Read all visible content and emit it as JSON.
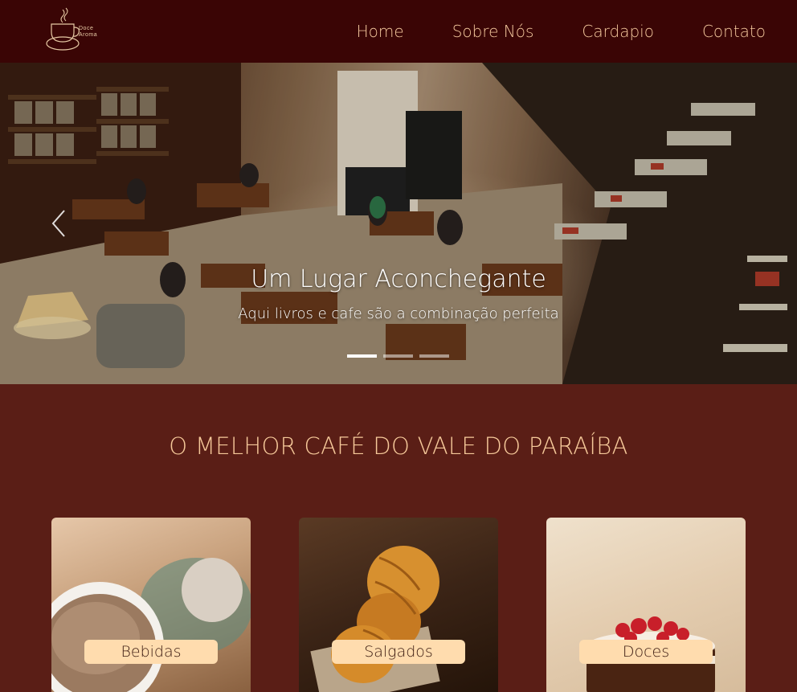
{
  "brand": {
    "name_line1": "Doce",
    "name_line2": "Aroma"
  },
  "nav": {
    "items": [
      {
        "label": "Home"
      },
      {
        "label": "Sobre Nós"
      },
      {
        "label": "Cardapio"
      },
      {
        "label": "Contato"
      }
    ]
  },
  "hero": {
    "title": "Um Lugar Aconchegante",
    "subtitle": "Aqui livros e cafe são a combinação perfeita",
    "slide_count": 3,
    "active_slide": 1
  },
  "section": {
    "title": "O MELHOR CAFÉ DO VALE DO PARAÍBA"
  },
  "cards": [
    {
      "label": "Bebidas"
    },
    {
      "label": "Salgados"
    },
    {
      "label": "Doces"
    }
  ],
  "colors": {
    "navbar_bg": "#3a0505",
    "page_bg": "#5a1e16",
    "accent": "#f6c99a",
    "card_label_bg": "#ffdcae"
  }
}
